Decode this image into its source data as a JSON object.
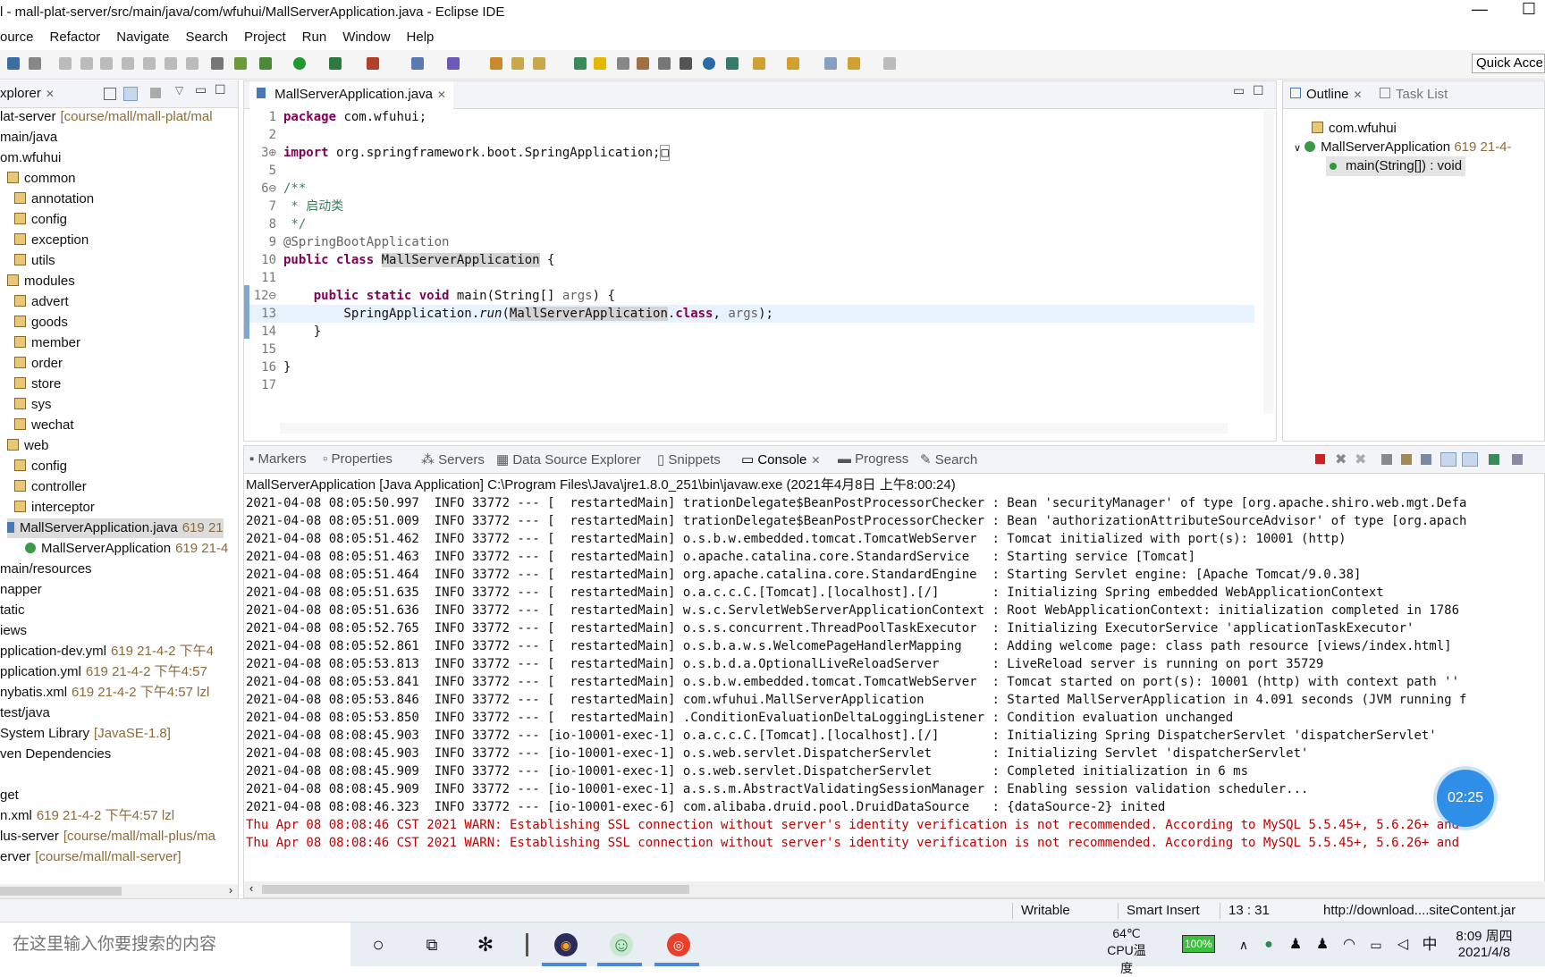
{
  "window": {
    "title": "l - mall-plat-server/src/main/java/com/wfuhui/MallServerApplication.java - Eclipse IDE",
    "controls": [
      "—",
      "☐"
    ]
  },
  "menu": [
    "ource",
    "Refactor",
    "Navigate",
    "Search",
    "Project",
    "Run",
    "Window",
    "Help"
  ],
  "toolbar": {
    "quick_access": "Quick Acce"
  },
  "explorer": {
    "tab_label": "xplorer",
    "tree": [
      {
        "text": "lat-server",
        "meta": "[course/mall/mall-plat/mal",
        "x": 0
      },
      {
        "text": "main/java",
        "meta": "",
        "x": 0
      },
      {
        "text": "om.wfuhui",
        "meta": "",
        "x": 0
      },
      {
        "text": "common",
        "meta": "",
        "x": 8,
        "pkg": true
      },
      {
        "text": "annotation",
        "meta": "",
        "x": 16,
        "pkg": true
      },
      {
        "text": "config",
        "meta": "",
        "x": 16,
        "pkg": true
      },
      {
        "text": "exception",
        "meta": "",
        "x": 16,
        "pkg": true
      },
      {
        "text": "utils",
        "meta": "",
        "x": 16,
        "pkg": true
      },
      {
        "text": "modules",
        "meta": "",
        "x": 8,
        "pkg": true
      },
      {
        "text": "advert",
        "meta": "",
        "x": 16,
        "pkg": true
      },
      {
        "text": "goods",
        "meta": "",
        "x": 16,
        "pkg": true
      },
      {
        "text": "member",
        "meta": "",
        "x": 16,
        "pkg": true
      },
      {
        "text": "order",
        "meta": "",
        "x": 16,
        "pkg": true
      },
      {
        "text": "store",
        "meta": "",
        "x": 16,
        "pkg": true
      },
      {
        "text": "sys",
        "meta": "",
        "x": 16,
        "pkg": true
      },
      {
        "text": "wechat",
        "meta": "",
        "x": 16,
        "pkg": true
      },
      {
        "text": "web",
        "meta": "",
        "x": 8,
        "pkg": true
      },
      {
        "text": "config",
        "meta": "",
        "x": 16,
        "pkg": true
      },
      {
        "text": "controller",
        "meta": "",
        "x": 16,
        "pkg": true
      },
      {
        "text": "interceptor",
        "meta": "",
        "x": 16,
        "pkg": true
      },
      {
        "text": "MallServerApplication.java",
        "meta": "619  21",
        "x": 8,
        "selected": true
      },
      {
        "text": "MallServerApplication",
        "meta": "619  21-4",
        "x": 28,
        "cls": true
      },
      {
        "text": "main/resources",
        "meta": "",
        "x": 0
      },
      {
        "text": "napper",
        "meta": "",
        "x": 0
      },
      {
        "text": "tatic",
        "meta": "",
        "x": 0
      },
      {
        "text": "iews",
        "meta": "",
        "x": 0
      },
      {
        "text": "pplication-dev.yml",
        "meta": "619  21-4-2 下午4",
        "x": 0
      },
      {
        "text": "pplication.yml",
        "meta": "619  21-4-2 下午4:57",
        "x": 0
      },
      {
        "text": "nybatis.xml",
        "meta": "619  21-4-2 下午4:57  lzl",
        "x": 0
      },
      {
        "text": "test/java",
        "meta": "",
        "x": 0
      },
      {
        "text": "System Library",
        "meta": "[JavaSE-1.8]",
        "x": 0
      },
      {
        "text": "ven Dependencies",
        "meta": "",
        "x": 0
      },
      {
        "text": "",
        "meta": "",
        "x": 0
      },
      {
        "text": "get",
        "meta": "",
        "x": 0
      },
      {
        "text": "n.xml",
        "meta": "619  21-4-2 下午4:57  lzl",
        "x": 0
      },
      {
        "text": "lus-server",
        "meta": "[course/mall/mall-plus/ma",
        "x": 0
      },
      {
        "text": "erver",
        "meta": "[course/mall/mall-server]",
        "x": 0
      }
    ]
  },
  "editor": {
    "tab_label": "MallServerApplication.java",
    "cursor_position": "13 : 31"
  },
  "outline": {
    "tab_label": "Outline",
    "task_tab": "Task List",
    "items": [
      {
        "label": "com.wfuhui",
        "meta": ""
      },
      {
        "label": "MallServerApplication",
        "meta": "619  21-4-"
      },
      {
        "label": "main(String[]) : void",
        "meta": ""
      }
    ]
  },
  "console": {
    "tabs": [
      "Markers",
      "Properties",
      "Servers",
      "Data Source Explorer",
      "Snippets",
      "Console",
      "Progress",
      "Search"
    ],
    "active_tab": "Console",
    "header": "MallServerApplication [Java Application] C:\\Program Files\\Java\\jre1.8.0_251\\bin\\javaw.exe (2021年4月8日 上午8:00:24)",
    "lines": [
      "2021-04-08 08:05:50.997  INFO 33772 --- [  restartedMain] trationDelegate$BeanPostProcessorChecker : Bean 'securityManager' of type [org.apache.shiro.web.mgt.Defa",
      "2021-04-08 08:05:51.009  INFO 33772 --- [  restartedMain] trationDelegate$BeanPostProcessorChecker : Bean 'authorizationAttributeSourceAdvisor' of type [org.apach",
      "2021-04-08 08:05:51.462  INFO 33772 --- [  restartedMain] o.s.b.w.embedded.tomcat.TomcatWebServer  : Tomcat initialized with port(s): 10001 (http)",
      "2021-04-08 08:05:51.463  INFO 33772 --- [  restartedMain] o.apache.catalina.core.StandardService   : Starting service [Tomcat]",
      "2021-04-08 08:05:51.464  INFO 33772 --- [  restartedMain] org.apache.catalina.core.StandardEngine  : Starting Servlet engine: [Apache Tomcat/9.0.38]",
      "2021-04-08 08:05:51.635  INFO 33772 --- [  restartedMain] o.a.c.c.C.[Tomcat].[localhost].[/]       : Initializing Spring embedded WebApplicationContext",
      "2021-04-08 08:05:51.636  INFO 33772 --- [  restartedMain] w.s.c.ServletWebServerApplicationContext : Root WebApplicationContext: initialization completed in 1786",
      "2021-04-08 08:05:52.765  INFO 33772 --- [  restartedMain] o.s.s.concurrent.ThreadPoolTaskExecutor  : Initializing ExecutorService 'applicationTaskExecutor'",
      "2021-04-08 08:05:52.861  INFO 33772 --- [  restartedMain] o.s.b.a.w.s.WelcomePageHandlerMapping    : Adding welcome page: class path resource [views/index.html]",
      "2021-04-08 08:05:53.813  INFO 33772 --- [  restartedMain] o.s.b.d.a.OptionalLiveReloadServer       : LiveReload server is running on port 35729",
      "2021-04-08 08:05:53.841  INFO 33772 --- [  restartedMain] o.s.b.w.embedded.tomcat.TomcatWebServer  : Tomcat started on port(s): 10001 (http) with context path ''",
      "2021-04-08 08:05:53.846  INFO 33772 --- [  restartedMain] com.wfuhui.MallServerApplication         : Started MallServerApplication in 4.091 seconds (JVM running f",
      "2021-04-08 08:05:53.850  INFO 33772 --- [  restartedMain] .ConditionEvaluationDeltaLoggingListener : Condition evaluation unchanged",
      "2021-04-08 08:08:45.903  INFO 33772 --- [io-10001-exec-1] o.a.c.c.C.[Tomcat].[localhost].[/]       : Initializing Spring DispatcherServlet 'dispatcherServlet'",
      "2021-04-08 08:08:45.903  INFO 33772 --- [io-10001-exec-1] o.s.web.servlet.DispatcherServlet        : Initializing Servlet 'dispatcherServlet'",
      "2021-04-08 08:08:45.909  INFO 33772 --- [io-10001-exec-1] o.s.web.servlet.DispatcherServlet        : Completed initialization in 6 ms",
      "2021-04-08 08:08:45.909  INFO 33772 --- [io-10001-exec-1] a.s.s.m.AbstractValidatingSessionManager : Enabling session validation scheduler...",
      "2021-04-08 08:08:46.323  INFO 33772 --- [io-10001-exec-6] com.alibaba.druid.pool.DruidDataSource   : {dataSource-2} inited"
    ],
    "warnings": [
      "Thu Apr 08 08:08:46 CST 2021 WARN: Establishing SSL connection without server's identity verification is not recommended. According to MySQL 5.5.45+, 5.6.26+ and",
      "Thu Apr 08 08:08:46 CST 2021 WARN: Establishing SSL connection without server's identity verification is not recommended. According to MySQL 5.5.45+, 5.6.26+ and"
    ],
    "timer": "02:25"
  },
  "status": {
    "writable": "Writable",
    "insert_mode": "Smart Insert",
    "position": "13 : 31",
    "url": "http://download....siteContent.jar"
  },
  "taskbar": {
    "search_placeholder": "在这里输入你要搜索的内容",
    "temp": "64℃",
    "temp_label": "CPU温度",
    "battery": "100%",
    "ime": "中",
    "time": "8:09 周四",
    "date": "2021/4/8"
  },
  "colors": {
    "keyword": "#7f0055",
    "comment": "#3f7f5f",
    "warn": "#c00000",
    "accent": "#2f8fe8"
  }
}
